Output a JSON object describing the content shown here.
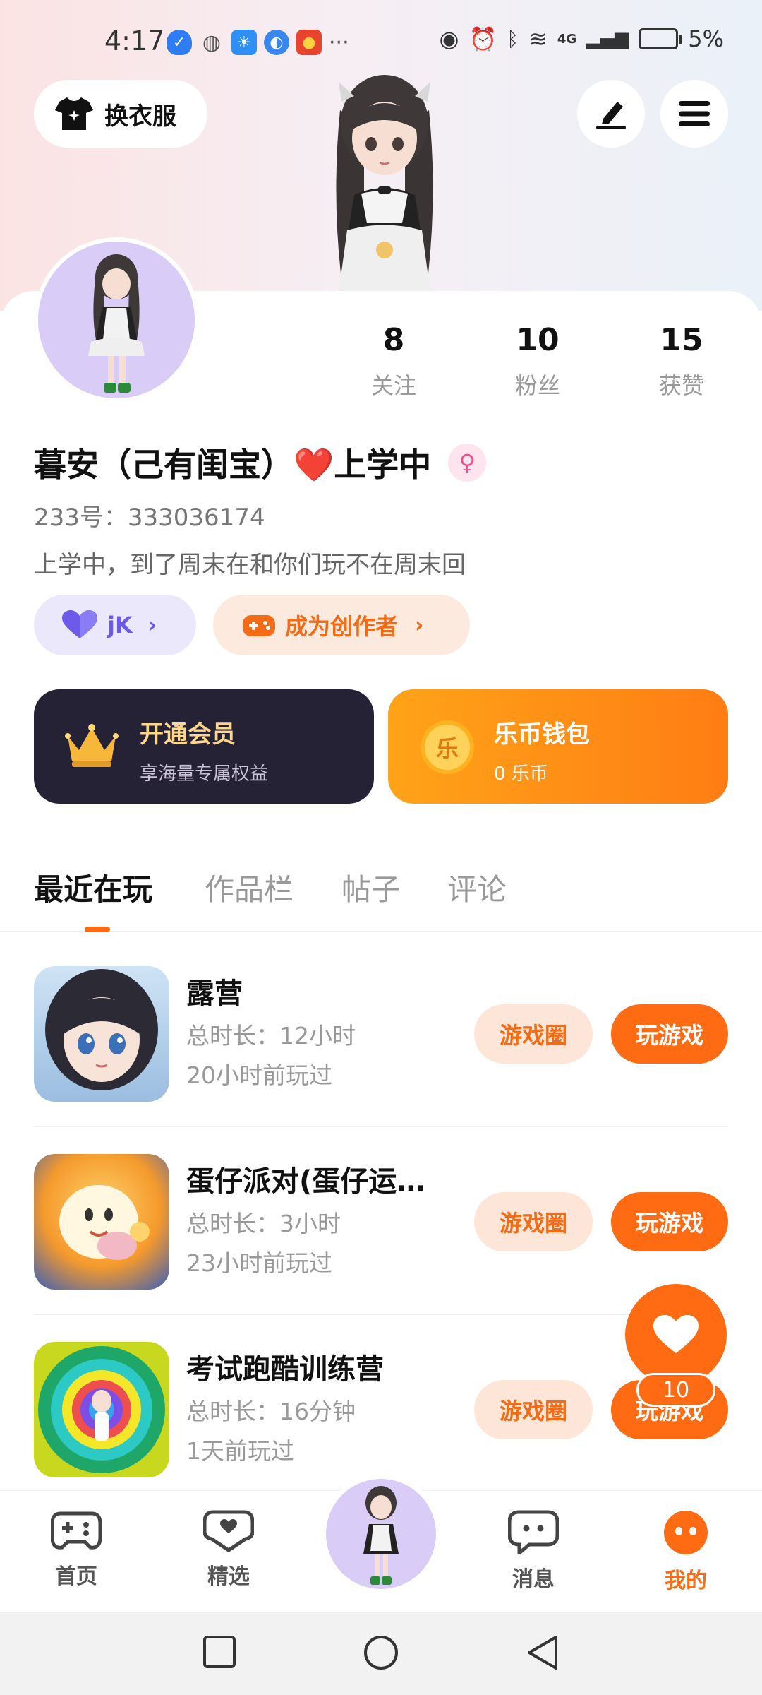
{
  "status_bar": {
    "time": "4:17",
    "network": "4G",
    "battery": "5%"
  },
  "header": {
    "outfit_label": "换衣服"
  },
  "profile": {
    "stats": [
      {
        "value": "8",
        "label": "关注"
      },
      {
        "value": "10",
        "label": "粉丝"
      },
      {
        "value": "15",
        "label": "获赞"
      }
    ],
    "nickname": "暮安（己有闺宝）❤️上学中",
    "gender_symbol": "♀",
    "id_line": "233号：333036174",
    "bio": "上学中，到了周末在和你们玩不在周末回",
    "tags": {
      "guild": "jK",
      "creator": "成为创作者"
    }
  },
  "promos": {
    "vip": {
      "title": "开通会员",
      "subtitle": "享海量专属权益"
    },
    "wallet": {
      "title": "乐币钱包",
      "subtitle": "0 乐币",
      "coin_char": "乐"
    }
  },
  "tabs": [
    "最近在玩",
    "作品栏",
    "帖子",
    "评论"
  ],
  "games": [
    {
      "name": "露营",
      "duration": "总时长：12小时",
      "last_played": "20小时前玩过",
      "circle_label": "游戏圈",
      "play_label": "玩游戏"
    },
    {
      "name": "蛋仔派对(蛋仔运…",
      "duration": "总时长：3小时",
      "last_played": "23小时前玩过",
      "circle_label": "游戏圈",
      "play_label": "玩游戏"
    },
    {
      "name": "考试跑酷训练营",
      "duration": "总时长：16分钟",
      "last_played": "1天前玩过",
      "circle_label": "游戏圈",
      "play_label": "玩游戏"
    }
  ],
  "fab": {
    "count": "10"
  },
  "bottom_nav": [
    {
      "label": "首页"
    },
    {
      "label": "精选"
    },
    {
      "label": "消息"
    },
    {
      "label": "我的"
    }
  ],
  "colors": {
    "accent": "#ff6b12",
    "vip_bg": "#252235",
    "guild_purple": "#6d5ae8"
  }
}
